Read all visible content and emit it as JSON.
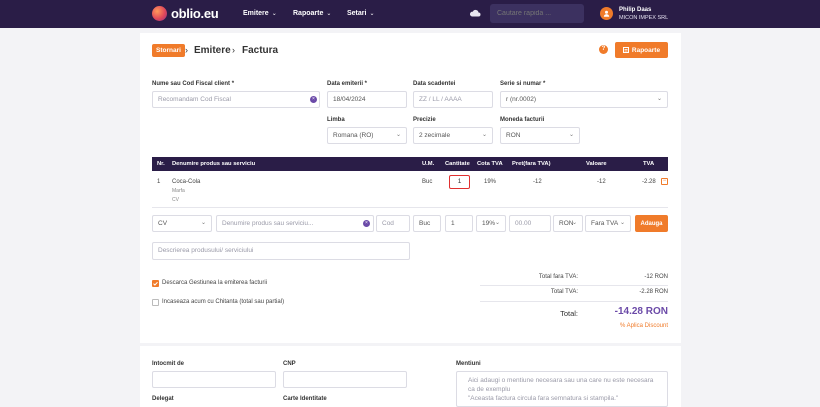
{
  "app": {
    "logo": "oblio.eu"
  },
  "nav": {
    "menus": [
      "Emitere",
      "Rapoarte",
      "Setari"
    ],
    "search_placeholder": "Cautare rapida ...",
    "user_name": "Philip Daas",
    "user_company": "MICON IMPEX SRL"
  },
  "breadcrumb": {
    "badge": "Stornari",
    "level1": "Emitere",
    "level2": "Factura",
    "sep": "›"
  },
  "header": {
    "reports_button": "Rapoarte"
  },
  "form": {
    "client_label": "Nume sau Cod Fiscal client *",
    "client_placeholder": "Recomandam Cod Fiscal",
    "issue_date_label": "Data emiterii *",
    "issue_date_value": "18/04/2024",
    "due_date_label": "Data scadentei",
    "due_date_placeholder": "ZZ / LL / AAAA",
    "series_label": "Serie si numar *",
    "series_value": "r (nr.0002)",
    "language_label": "Limba",
    "language_value": "Romana (RO)",
    "precision_label": "Precizie",
    "precision_value": "2 zecimale",
    "currency_label": "Moneda facturii",
    "currency_value": "RON"
  },
  "table": {
    "headers": [
      "Nr.",
      "Denumire produs sau serviciu",
      "U.M.",
      "Cantitate",
      "Cota TVA",
      "Pret(fara TVA)",
      "Valoare",
      "TVA"
    ],
    "rows": [
      {
        "nr": "1",
        "name": "Coca-Cola",
        "desc1": "Marfa",
        "desc2": "CV",
        "um": "Buc",
        "qty": "1",
        "vat_rate": "19%",
        "price": "-12",
        "value": "-12",
        "vat": "-2.28"
      }
    ]
  },
  "add_row": {
    "type": "CV",
    "product_placeholder": "Denumire produs sau serviciu...",
    "code_placeholder": "Cod",
    "um": "Buc",
    "qty": "1",
    "vat": "19%",
    "price_placeholder": "00.00",
    "currency": "RON",
    "vat_mode": "Fara TVA",
    "add_button": "Adauga"
  },
  "description_placeholder": "Descrierea produsului/ serviciului",
  "options": {
    "stock_label": "Descarca Gestiunea la emiterea facturii",
    "stock_checked": true,
    "receipt_label": "Incaseaza acum cu Chitanta (total sau partial)",
    "receipt_checked": false
  },
  "totals": {
    "net_label": "Total fara TVA:",
    "net_value": "-12 RON",
    "vat_label": "Total TVA:",
    "vat_value": "-2.28 RON",
    "total_label": "Total:",
    "total_value": "-14.28 RON",
    "discount_link": "% Aplica Discount"
  },
  "footer": {
    "prepared_label": "Intocmit de",
    "cnp_label": "CNP",
    "delegate_label": "Delegat",
    "id_card_label": "Carte Identitate",
    "notes_label": "Mentiuni",
    "notes_placeholder_line1": "Aici adaugi o mentiune necesara sau una care nu este necesara",
    "notes_placeholder_line2": "ca de exemplu",
    "notes_placeholder_line3": "\"Aceasta factura circula fara semnatura si stampila.\""
  },
  "colors": {
    "accent": "#f07b2a",
    "nav_bg": "#2a1d47",
    "brand_purple": "#6b4aa8",
    "error_red": "#e03030"
  }
}
